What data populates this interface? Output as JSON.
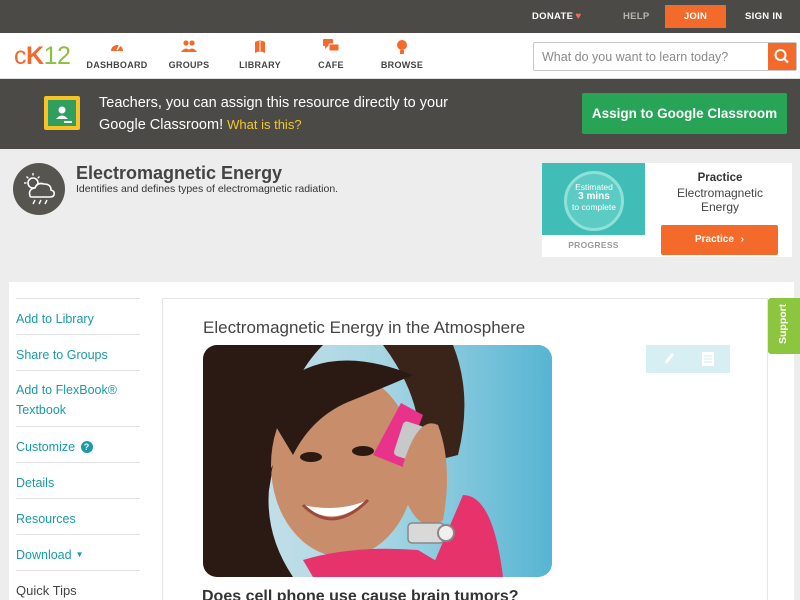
{
  "topbar": {
    "donate": "DONATE",
    "help": "HELP",
    "join": "JOIN",
    "sign_in": "SIGN IN"
  },
  "nav": {
    "logo_c": "c",
    "logo_k": "K",
    "logo_num": "12",
    "items": [
      {
        "label": "DASHBOARD",
        "icon": "dashboard-icon"
      },
      {
        "label": "GROUPS",
        "icon": "groups-icon"
      },
      {
        "label": "LIBRARY",
        "icon": "library-icon"
      },
      {
        "label": "CAFE",
        "icon": "cafe-icon"
      },
      {
        "label": "BROWSE",
        "icon": "browse-icon"
      }
    ],
    "search_placeholder": "What do you want to learn today?"
  },
  "classroom_banner": {
    "text": "Teachers, you can assign this resource directly to your Google Classroom!",
    "what_is_this": "What is this?",
    "button": "Assign to Google Classroom"
  },
  "concept": {
    "title": "Electromagnetic Energy",
    "description": "Identifies and defines types of electromagnetic radiation."
  },
  "practice_card": {
    "estimated": "Estimated",
    "mins": "3 mins",
    "to_complete": "to complete",
    "progress_label": "PROGRESS",
    "label": "Practice",
    "name": "Electromagnetic Energy",
    "button": "Practice"
  },
  "sidebar": {
    "items": [
      {
        "label": "Add to Library"
      },
      {
        "label": "Share to Groups"
      },
      {
        "label": "Add to FlexBook® Textbook"
      },
      {
        "label": "Customize"
      },
      {
        "label": "Details"
      },
      {
        "label": "Resources"
      },
      {
        "label": "Download"
      }
    ],
    "quick_tips": "Quick Tips"
  },
  "article": {
    "title": "Electromagnetic Energy in the Atmosphere",
    "question": "Does cell phone use cause brain tumors?"
  },
  "support_tab": "Support",
  "colors": {
    "accent_orange": "#f36a2b",
    "accent_green": "#8bbf3f",
    "classroom_green": "#28a457",
    "link_teal": "#1a9aa6",
    "dark_bar": "#4c4a46"
  }
}
